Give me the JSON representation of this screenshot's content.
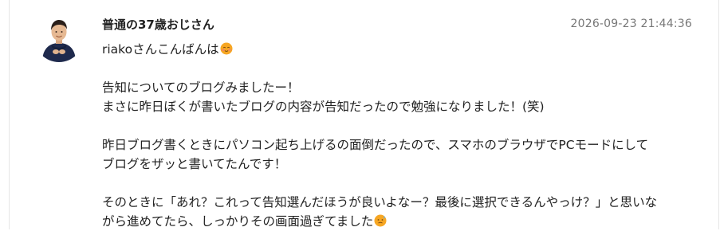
{
  "comment": {
    "author": "普通の37歳おじさん",
    "timestamp": "2026-09-23 21:44:36",
    "lines": {
      "l1": "riakoさんこんばんは",
      "l2": "告知についてのブログみましたー！",
      "l3": "まさに昨日ぼくが書いたブログの内容が告知だったので勉強になりました！(笑)",
      "l4": "昨日ブログ書くときにパソコン起ち上げるの面倒だったので、スマホのブラウザでPCモードにして",
      "l5": "ブログをザッと書いてたんです！",
      "l6": "そのときに「あれ？これって告知選んだほうが良いよなー？最後に選択できるんやっけ？」と思いな",
      "l7": "がら進めてたら、しっかりその画面過ぎてました"
    }
  },
  "icons": {
    "avatar": "avatar-person-photo",
    "emoji_greeting": "smiling-face-emoji",
    "emoji_end": "sweat-face-emoji"
  },
  "colors": {
    "text": "#222222",
    "timestamp": "#777777",
    "border": "#e6e6e6",
    "emoji": "#f6a623"
  }
}
